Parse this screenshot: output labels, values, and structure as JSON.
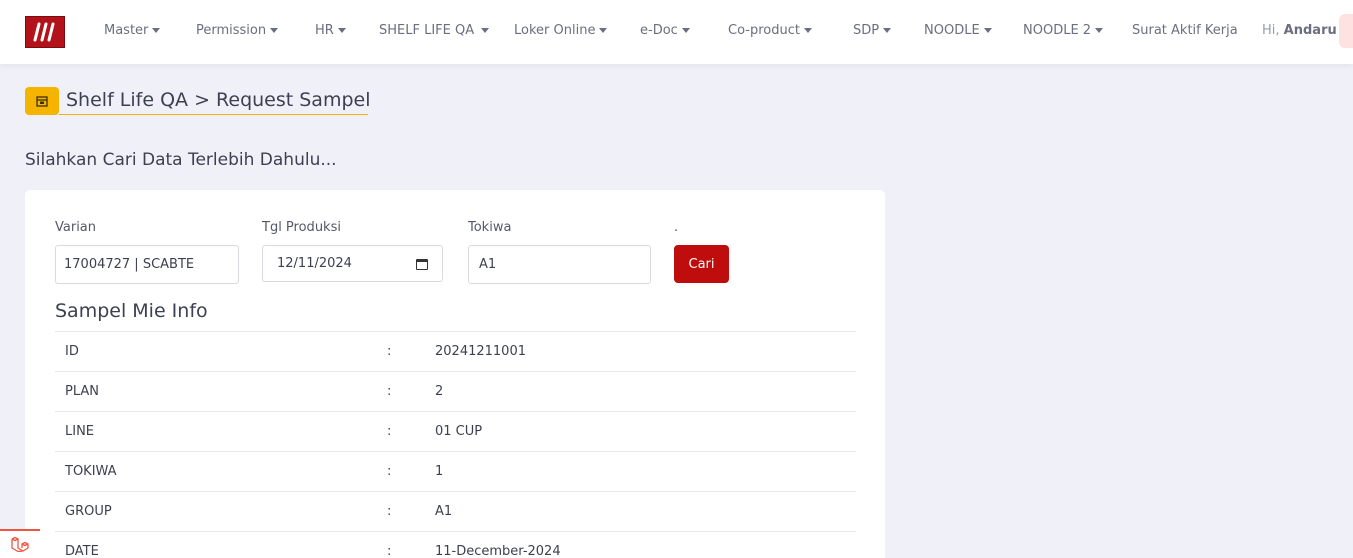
{
  "nav": {
    "items": [
      {
        "label": "Master",
        "dropdown": true
      },
      {
        "label": "Permission",
        "dropdown": true
      },
      {
        "label": "HR",
        "dropdown": true
      },
      {
        "label": "SHELF LIFE QA",
        "dropdown": true
      },
      {
        "label": "Loker Online",
        "dropdown": true
      },
      {
        "label": "e-Doc",
        "dropdown": true
      },
      {
        "label": "Co-product",
        "dropdown": true
      },
      {
        "label": "SDP",
        "dropdown": true
      },
      {
        "label": "NOODLE",
        "dropdown": true
      },
      {
        "label": "NOODLE 2",
        "dropdown": true
      },
      {
        "label": "Surat Aktif Kerja",
        "dropdown": false
      }
    ],
    "greeting": "Hi,",
    "user": "Andaru"
  },
  "breadcrumb": {
    "text": "Shelf Life QA > Request Sampel",
    "icon": "calendar-icon"
  },
  "subtitle": "Silahkan Cari Data Terlebih Dahulu...",
  "form": {
    "varian_label": "Varian",
    "varian_value": "17004727 | SCABTE",
    "tgl_label": "Tgl Produksi",
    "tgl_value": "12/11/2024",
    "tokiwa_label": "Tokiwa",
    "tokiwa_value": "A1",
    "button_label_caption": ".",
    "button_label": "Cari"
  },
  "info": {
    "title": "Sampel Mie Info",
    "rows": [
      {
        "key": "ID",
        "sep": ":",
        "value": "20241211001"
      },
      {
        "key": "PLAN",
        "sep": ":",
        "value": "2"
      },
      {
        "key": "LINE",
        "sep": ":",
        "value": "01 CUP"
      },
      {
        "key": "TOKIWA",
        "sep": ":",
        "value": "1"
      },
      {
        "key": "GROUP",
        "sep": ":",
        "value": "A1"
      },
      {
        "key": "DATE",
        "sep": ":",
        "value": "11-December-2024"
      }
    ]
  },
  "colors": {
    "brand": "#b3121a",
    "accent": "#f5b400",
    "button": "#bf0d0d"
  }
}
